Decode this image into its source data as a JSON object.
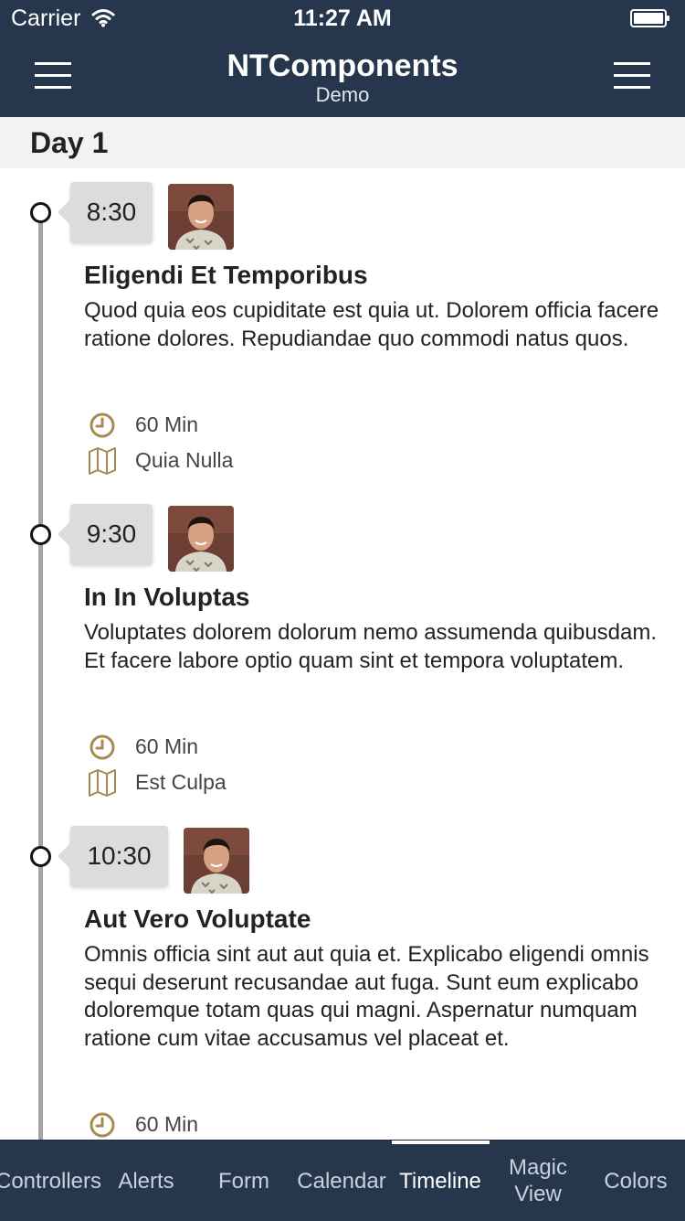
{
  "status_bar": {
    "carrier": "Carrier",
    "time": "11:27 AM"
  },
  "nav": {
    "title": "NTComponents",
    "subtitle": "Demo"
  },
  "section": {
    "title": "Day 1"
  },
  "events": [
    {
      "time": "8:30",
      "title": "Eligendi Et Temporibus",
      "description": "Quod quia eos cupiditate est quia ut. Dolorem officia facere ratione dolores. Repudiandae quo commodi natus quos.",
      "duration": "60 Min",
      "location": "Quia Nulla"
    },
    {
      "time": "9:30",
      "title": "In In Voluptas",
      "description": "Voluptates dolorem dolorum nemo assumenda quibusdam. Et facere labore optio quam sint et tempora voluptatem.",
      "duration": "60 Min",
      "location": "Est Culpa"
    },
    {
      "time": "10:30",
      "title": "Aut Vero Voluptate",
      "description": "Omnis officia sint aut aut quia et. Explicabo eligendi omnis sequi deserunt recusandae aut fuga. Sunt eum explicabo doloremque totam quas qui magni. Aspernatur numquam ratione cum vitae accusamus vel placeat et.",
      "duration": "60 Min"
    }
  ],
  "tabs": [
    {
      "label": "Controllers"
    },
    {
      "label": "Alerts"
    },
    {
      "label": "Form"
    },
    {
      "label": "Calendar"
    },
    {
      "label": "Timeline"
    },
    {
      "label": "Magic View"
    },
    {
      "label": "Colors"
    }
  ],
  "active_tab": "Timeline",
  "colors": {
    "nav_bar": "#26374d",
    "accent_icon": "#a88a50",
    "timeline_line": "#a3a3a3"
  }
}
